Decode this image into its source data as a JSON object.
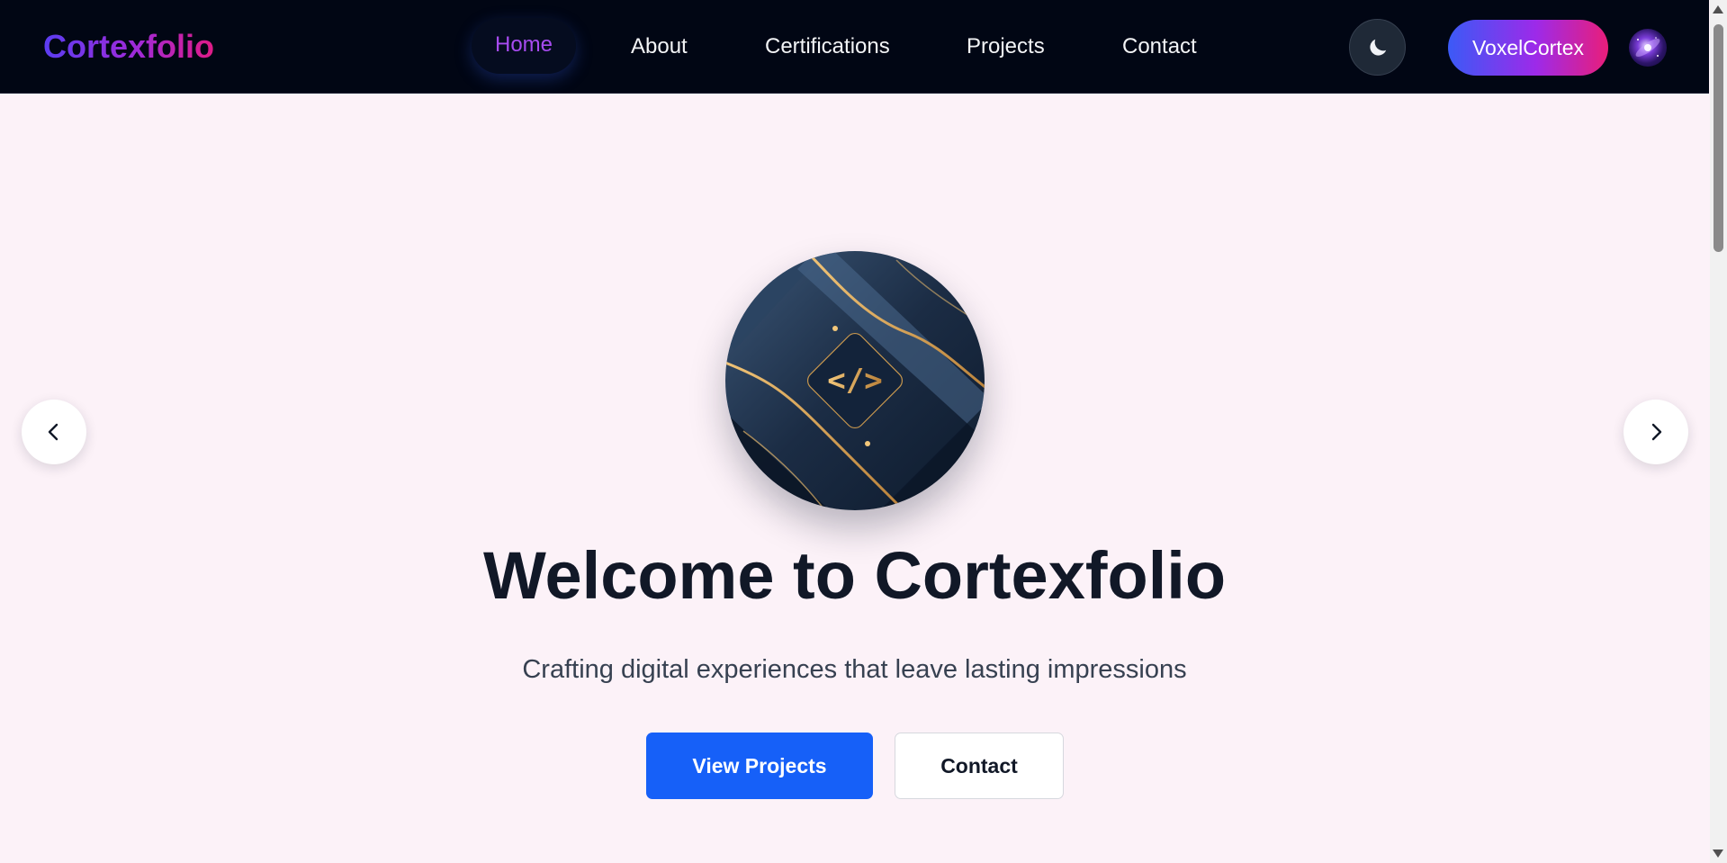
{
  "navbar": {
    "brand": "Cortexfolio",
    "links": [
      {
        "label": "Home",
        "active": true
      },
      {
        "label": "About",
        "active": false
      },
      {
        "label": "Certifications",
        "active": false
      },
      {
        "label": "Projects",
        "active": false
      },
      {
        "label": "Contact",
        "active": false
      }
    ],
    "theme_toggle_icon": "moon-icon",
    "user_name": "VoxelCortex",
    "avatar_icon": "galaxy-avatar"
  },
  "hero": {
    "image_icon": "code-brackets-icon",
    "image_glyph": "</>",
    "title": "Welcome to Cortexfolio",
    "subtitle": "Crafting digital experiences that leave lasting impressions",
    "primary_button": "View Projects",
    "secondary_button": "Contact"
  },
  "carousel": {
    "prev_icon": "chevron-left-icon",
    "next_icon": "chevron-right-icon"
  },
  "colors": {
    "navbar_bg": "#010614",
    "page_bg": "#fcf2f8",
    "active_link": "#a74bf0",
    "primary_button": "#1660f8",
    "brand_gradient": [
      "#5b3df2",
      "#a02ad8",
      "#e01b86"
    ],
    "user_pill_gradient": [
      "#3b5af6",
      "#9d2ae9",
      "#e91e7a"
    ]
  }
}
